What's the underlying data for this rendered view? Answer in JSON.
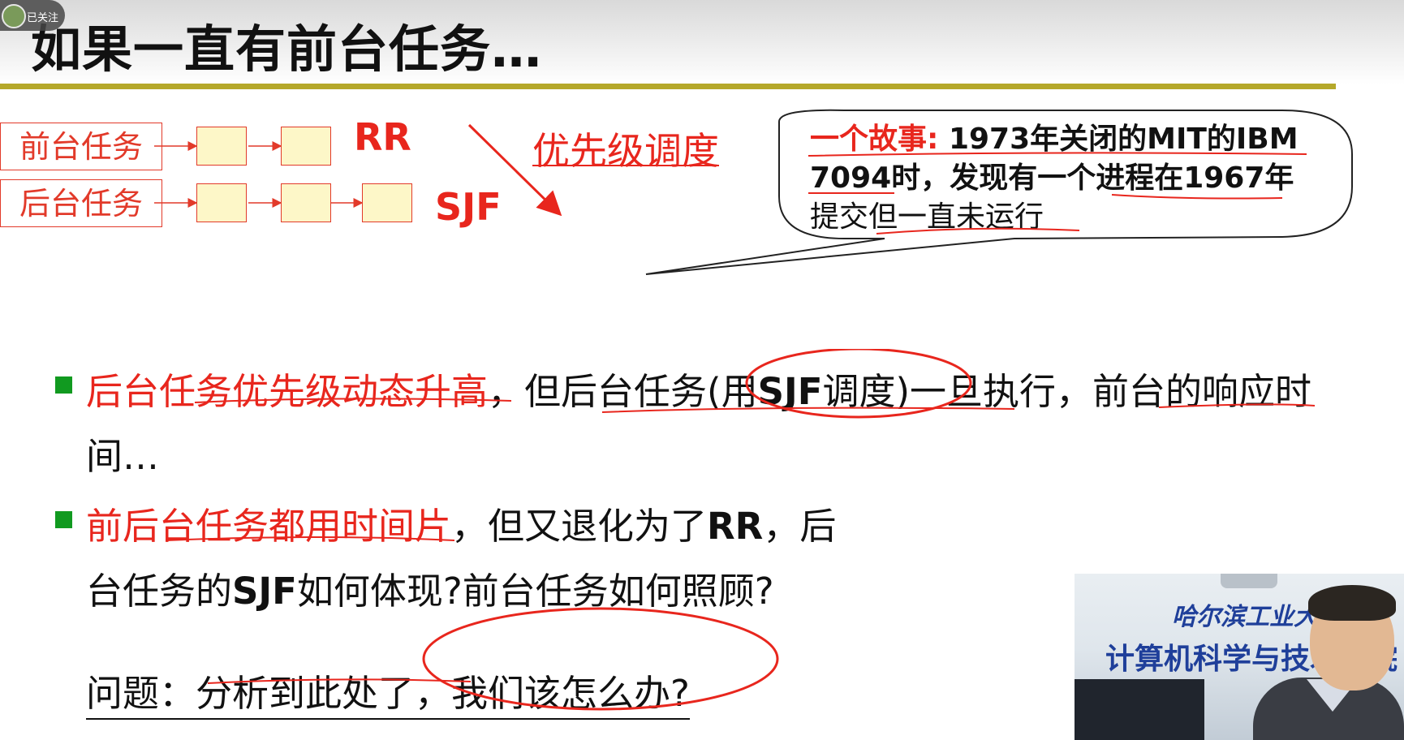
{
  "follow_badge": {
    "label": "已关注"
  },
  "slide": {
    "title": "如果一直有前台任务…",
    "queues": {
      "foreground_label": "前台任务",
      "background_label": "后台任务",
      "rr_label": "RR",
      "sjf_label": "SJF",
      "priority_label": "优先级调度"
    },
    "story": {
      "line1_red": "一个故事:",
      "line1_rest": " 1973年关闭的MIT的IBM",
      "line2": "7094时，发现有一个进程在1967年",
      "line3": "提交但一直未运行"
    },
    "bullet1": {
      "red": "后台任务优先级动态升高",
      "mid": "，但后台任务(用",
      "bold": "SJF",
      "rest": "调度)一旦执行，前台的响应时",
      "line2": "间…"
    },
    "bullet2": {
      "red": "前后台任务都用时间片",
      "mid": "，但又退化为了",
      "bold": "RR",
      "rest": "，后",
      "line2_a": "台任务的",
      "line2_bold": "SJF",
      "line2_b": "如何体现?前台任务如何照顾?"
    },
    "question": "问题：分析到此处了，我们该怎么办?"
  },
  "webcam": {
    "school_sign": "哈尔滨工业大",
    "dept_sign": "计算机科学与技术学院"
  },
  "colors": {
    "accent_red": "#e8261d",
    "title_rule": "#b5a82a",
    "bullet_green": "#119a20",
    "queue_box_fill": "#fdf7c8"
  }
}
